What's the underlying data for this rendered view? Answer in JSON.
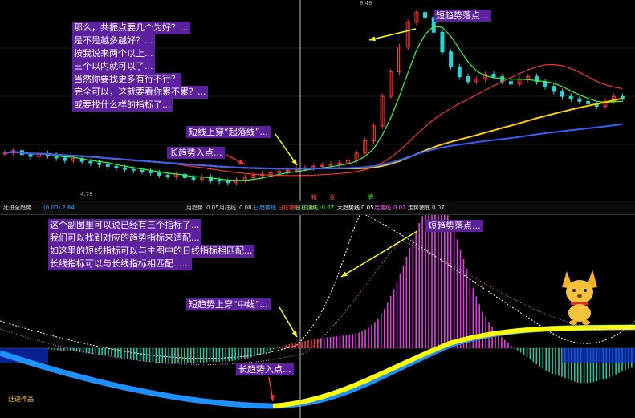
{
  "top_labels": {
    "high_price": "8.49",
    "low_price": "4.78"
  },
  "annotations": {
    "top_left_lines": [
      "那么，共振点要几个为好？...",
      "是不是越多越好？...",
      "按我说来两个以上...",
      "三个以内就可以了...",
      "当然你要找更多有行不行？",
      "完全可以，这就要看你累不累？...",
      "或要找什么样的指标了..."
    ],
    "top_short_fall": "短趋势落点...",
    "top_cross": "短线上穿“起落线”...",
    "top_long_entry": "长趋势入点...",
    "bottom_left_lines": [
      "这个副图里可以说已经有三个指标了...",
      "我们可以找到对应的趋势指标来适配...",
      "如这里的短线指标可以与主图中的日线指标相匹配...",
      "长线指标可以与长线指标相匹配......"
    ],
    "bottom_short_fall": "短趋势落点...",
    "bottom_cross": "短趋势上穿“中线”...",
    "bottom_long_entry": "长趋势入点..."
  },
  "markers": {
    "m1": "精",
    "m2": "涨",
    "m3": "牌"
  },
  "indicator_bar": {
    "name": "廷进全趋势",
    "name_value": "(0.00) 2.64",
    "items": [
      {
        "label": "月趋势",
        "value": "0.05",
        "color": "#dddddd"
      },
      {
        "label": "月柱线",
        "value": "0.08",
        "color": "#dddddd"
      },
      {
        "label": "日趋势线",
        "value": "",
        "color": "#3aa0ff"
      },
      {
        "label": "日柱铺线",
        "value": "-0.06",
        "color": "#ff3b3b"
      },
      {
        "label": "日柱铺线",
        "value": "-0.07",
        "color": "#3cff3c"
      },
      {
        "label": "大趋势线",
        "value": "0.05",
        "color": "#ffffff"
      },
      {
        "label": "走势线",
        "value": "0.07",
        "color": "#ff66ff"
      },
      {
        "label": "走势铺底",
        "value": "0.07",
        "color": "#dddddd"
      }
    ]
  },
  "footer_brand": "廷进作品",
  "colors": {
    "up": "#ff3030",
    "down": "#29d3d3",
    "magenta": "#e040e0",
    "yellow": "#ffff00",
    "blue": "#1e90ff",
    "purple_tag": "#5b1fa0"
  },
  "chart_data": [
    {
      "type": "candlestick",
      "title": "",
      "ylim": [
        4.78,
        8.49
      ],
      "note": "daily candles with moving averages; prices read at low 4.78 and peak 8.49",
      "close": [
        5.45,
        5.5,
        5.42,
        5.38,
        5.44,
        5.4,
        5.35,
        5.3,
        5.34,
        5.28,
        5.25,
        5.22,
        5.18,
        5.15,
        5.12,
        5.1,
        5.08,
        5.05,
        5.0,
        4.98,
        5.02,
        4.95,
        4.92,
        4.96,
        4.9,
        4.88,
        4.85,
        4.9,
        4.95,
        5.0,
        5.02,
        5.05,
        5.08,
        5.1,
        5.12,
        5.15,
        5.18,
        5.2,
        5.22,
        5.25,
        5.3,
        5.45,
        5.7,
        6.0,
        6.6,
        7.1,
        7.6,
        8.1,
        8.3,
        8.2,
        7.9,
        7.5,
        7.2,
        7.0,
        6.9,
        6.95,
        7.05,
        7.0,
        6.9,
        6.85,
        6.95,
        7.0,
        6.9,
        6.8,
        6.7,
        6.6,
        6.55,
        6.5,
        6.45,
        6.4,
        6.5,
        6.6,
        6.55
      ]
    },
    {
      "type": "histogram",
      "title": "",
      "series": [
        {
          "name": "日趋势线",
          "color": "#3aa0ff"
        },
        {
          "name": "大趋势线",
          "color": "#ffffff"
        },
        {
          "name": "走势线",
          "color": "#ff66ff"
        }
      ]
    }
  ]
}
